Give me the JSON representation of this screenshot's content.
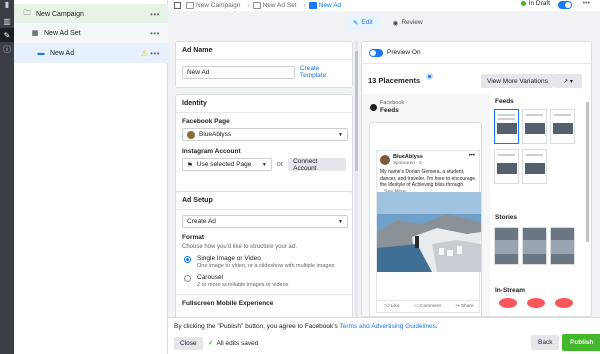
{
  "tree": {
    "campaign": "New Campaign",
    "adset": "New Ad Set",
    "ad": "New Ad"
  },
  "topbar": {
    "crumbs": [
      "New Campaign",
      "New Ad Set",
      "New Ad"
    ],
    "status": "In Draft"
  },
  "tabs": {
    "edit": "Edit",
    "review": "Review"
  },
  "ad_name": {
    "title": "Ad Name",
    "value": "New Ad",
    "create_template": "Create Template"
  },
  "identity": {
    "title": "Identity",
    "fb_page_label": "Facebook Page",
    "fb_page_value": "BlueAblyss",
    "ig_label": "Instagram Account",
    "ig_value": "Use selected Page",
    "or": "or",
    "connect": "Connect Account"
  },
  "ad_setup": {
    "title": "Ad Setup",
    "select": "Create Ad",
    "format_label": "Format",
    "format_sub": "Choose how you'd like to structure your ad.",
    "opt1_title": "Single Image or Video",
    "opt1_sub": "One image or video, or a slideshow with multiple images",
    "opt2_title": "Carousel",
    "opt2_sub": "2 or more scrollable images or videos",
    "fullscreen": "Fullscreen Mobile Experience"
  },
  "preview": {
    "toggle_label": "Preview On",
    "placements": "13 Placements",
    "view_more": "View More Variations",
    "platform": "Facebook",
    "placement": "Feeds",
    "post_name": "BlueAblyss",
    "post_sponsored": "Sponsored · ⊙",
    "post_text": "My name's Dorian Gemera, a student, dancer, and traveler. I'm here to encourage the lifestyle of Achieving bliss through",
    "see_more": "...See More",
    "like": "Like",
    "comment": "Comment",
    "share": "Share",
    "sections": {
      "feeds": "Feeds",
      "stories": "Stories",
      "instream": "In-Stream"
    }
  },
  "bottom": {
    "legal_prefix": "By clicking the \"Publish\" button, you agree to Facebook's ",
    "legal_link": "Terms and Advertising Guidelines",
    "legal_suffix": ".",
    "close": "Close",
    "saved": "All edits saved",
    "back": "Back",
    "publish": "Publish"
  },
  "colors": {
    "accent": "#1877f2",
    "publish": "#42b72a",
    "warning": "#f7b928"
  }
}
